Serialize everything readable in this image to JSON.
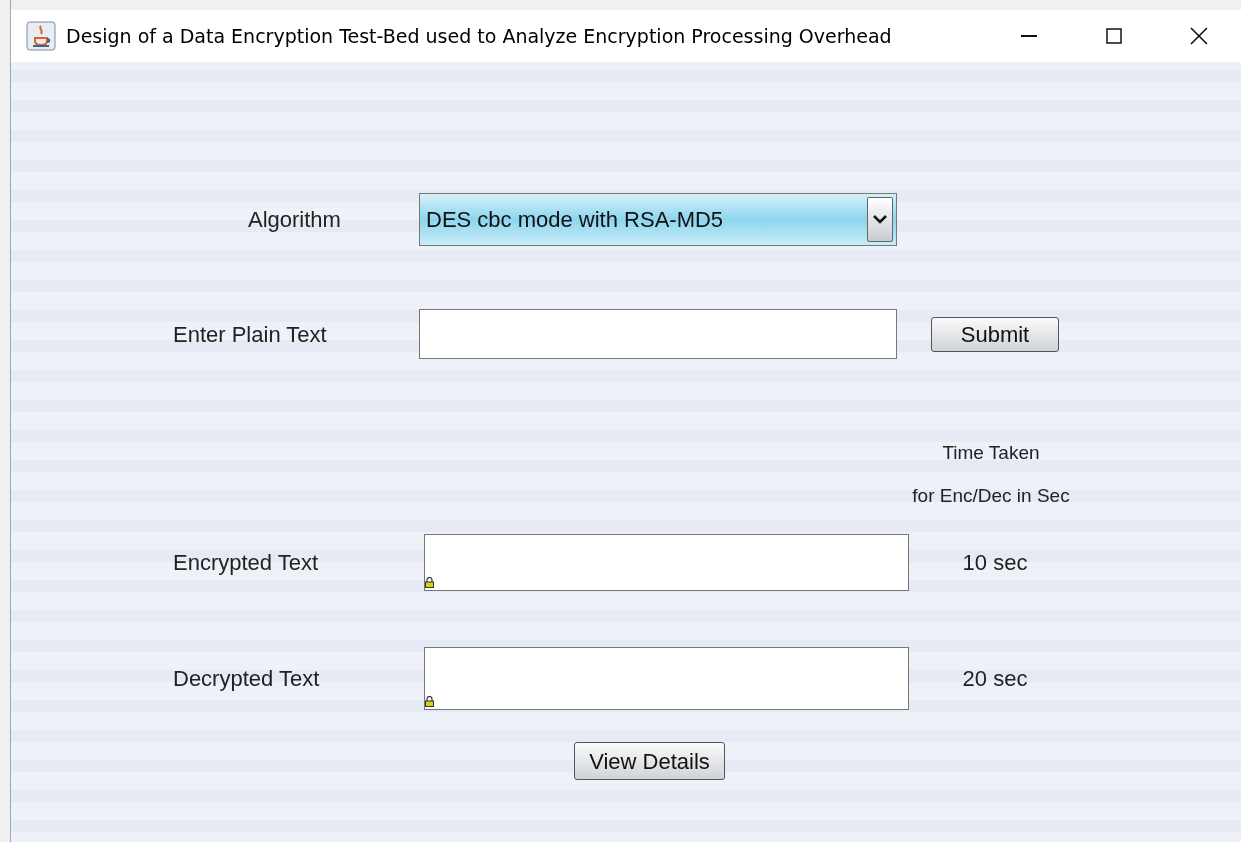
{
  "window": {
    "title": "Design of a Data Encryption Test-Bed used to Analyze Encryption Processing Overhead"
  },
  "algorithm": {
    "label": "Algorithm",
    "value": "DES cbc mode with RSA-MD5"
  },
  "plain_text": {
    "label": "Enter Plain Text"
  },
  "submit_button": "Submit",
  "time_header": [
    "Time Taken",
    "for Enc/Dec in Sec"
  ],
  "outputs": [
    {
      "label": "Encrypted Text",
      "time": "10 sec"
    },
    {
      "label": "Decrypted Text",
      "time": "20 sec"
    }
  ],
  "view_details_button": "View Details"
}
